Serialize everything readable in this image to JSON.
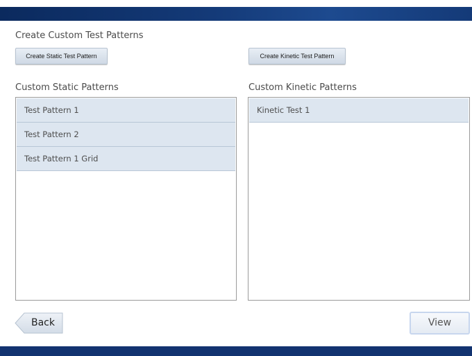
{
  "header": {
    "title": "Create Custom Test Patterns"
  },
  "buttons": {
    "create_static": "Create Static Test Pattern",
    "create_kinetic": "Create Kinetic Test Pattern",
    "back": "Back",
    "view": "View"
  },
  "static_list": {
    "label": "Custom Static Patterns",
    "items": [
      "Test Pattern 1",
      "Test Pattern 2",
      "Test Pattern 1 Grid"
    ]
  },
  "kinetic_list": {
    "label": "Custom Kinetic Patterns",
    "items": [
      "Kinetic Test 1"
    ]
  },
  "colors": {
    "accent_bar": "#123370",
    "list_item_bg": "#dde6f0"
  }
}
